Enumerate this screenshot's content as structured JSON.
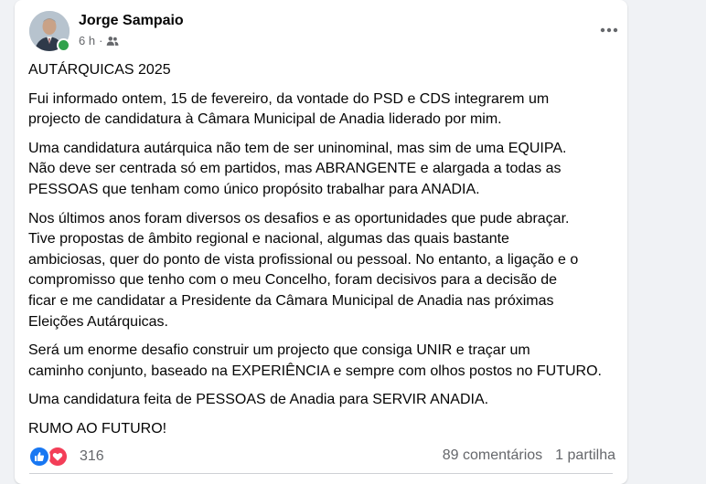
{
  "post": {
    "author": "Jorge Sampaio",
    "time": "6 h",
    "separator": "·",
    "paragraphs": [
      "AUTÁRQUICAS 2025",
      "Fui informado ontem, 15 de fevereiro, da vontade do PSD e CDS integrarem um\nprojecto de candidatura à Câmara Municipal de Anadia liderado por mim.",
      "Uma candidatura autárquica não tem de ser uninominal, mas sim de uma EQUIPA.\nNão deve ser centrada só em partidos, mas ABRANGENTE e alargada a todas  as\nPESSOAS que tenham como único propósito trabalhar para ANADIA.",
      "Nos últimos anos foram diversos os desafios e as oportunidades que pude abraçar.\nTive propostas de âmbito regional e nacional, algumas das quais bastante\nambiciosas, quer do ponto de vista profissional ou pessoal. No entanto, a ligação e o\ncompromisso que tenho com o meu Concelho, foram decisivos para a decisão de\nficar e me candidatar a Presidente da Câmara Municipal de Anadia nas próximas\nEleições Autárquicas.",
      "Será um enorme desafio construir um projecto que consiga UNIR e traçar um\ncaminho conjunto, baseado na EXPERIÊNCIA e sempre com olhos postos no FUTURO.",
      "Uma candidatura feita de PESSOAS de Anadia para SERVIR ANADIA.",
      "RUMO AO FUTURO!"
    ],
    "icons": {
      "audience": "friends-icon",
      "more": "more-options-icon",
      "reaction_1": "like-icon",
      "reaction_2": "love-icon"
    }
  },
  "footer": {
    "reactions_count": "316",
    "comments": "89 comentários",
    "shares": "1 partilha"
  },
  "colors": {
    "like": "#1877f2",
    "love": "#f33e58",
    "online": "#31a24c",
    "secondary_text": "#65676b"
  }
}
